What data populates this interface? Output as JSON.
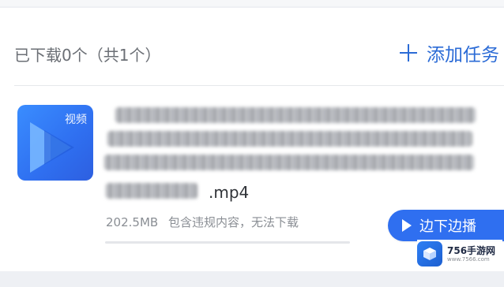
{
  "header": {
    "download_count": "已下载0个（共1个）",
    "add_task_label": "添加任务"
  },
  "file": {
    "thumb_tag": "视频",
    "extension": ".mp4",
    "size": "202.5MB",
    "status": "包含违规内容，无法下载",
    "action_label": "边下边播"
  },
  "watermark": {
    "title": "756手游网",
    "url": "www.7566.com"
  },
  "colors": {
    "accent": "#2f6ff0",
    "text_primary": "#303338",
    "text_secondary": "#8a8e94",
    "background": "#eef0f4"
  }
}
